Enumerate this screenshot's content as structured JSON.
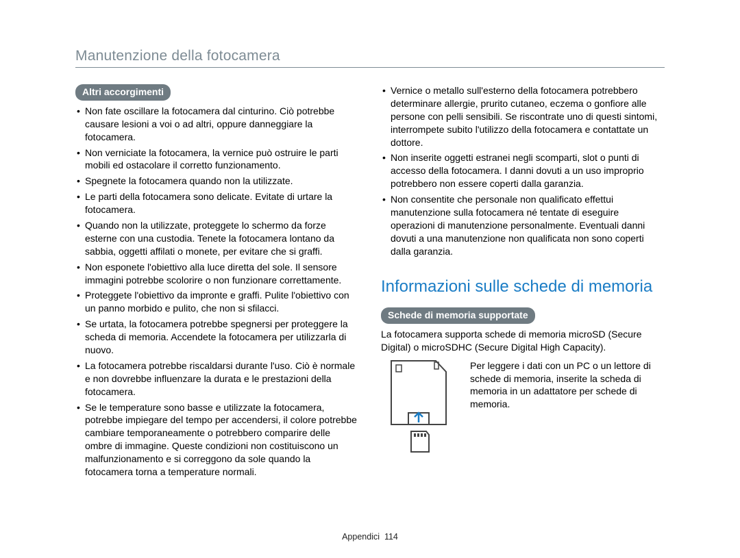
{
  "header": {
    "title": "Manutenzione della fotocamera"
  },
  "left": {
    "heading": "Altri accorgimenti",
    "bullets": [
      "Non fate oscillare la fotocamera dal cinturino. Ciò potrebbe causare lesioni a voi o ad altri, oppure danneggiare la fotocamera.",
      "Non verniciate la fotocamera, la vernice può ostruire le parti mobili ed ostacolare il corretto funzionamento.",
      "Spegnete la fotocamera quando non la utilizzate.",
      "Le parti della fotocamera sono delicate. Evitate di urtare la fotocamera.",
      "Quando non la utilizzate, proteggete lo schermo da forze esterne con una custodia. Tenete la fotocamera lontano da sabbia, oggetti affilati o monete, per evitare che si graffi.",
      "Non esponete l'obiettivo alla luce diretta del sole. Il sensore immagini potrebbe scolorire o non funzionare correttamente.",
      "Proteggete l'obiettivo da impronte e graffi. Pulite l'obiettivo con un panno morbido e pulito, che non si sfilacci.",
      "Se urtata, la fotocamera potrebbe spegnersi per proteggere la scheda di memoria. Accendete la fotocamera per utilizzarla di nuovo.",
      "La fotocamera potrebbe riscaldarsi durante l'uso. Ciò è normale e non dovrebbe influenzare la durata e le prestazioni della fotocamera.",
      "Se le temperature sono basse e utilizzate la fotocamera, potrebbe impiegare del tempo per accendersi, il colore potrebbe cambiare temporaneamente o potrebbero comparire delle ombre di immagine. Queste condizioni non costituiscono un malfunzionamento e si correggono da sole quando la fotocamera torna a temperature normali."
    ]
  },
  "right": {
    "bullets_top": [
      "Vernice o metallo sull'esterno della fotocamera potrebbero determinare allergie, prurito cutaneo, eczema o gonfiore alle persone con pelli sensibili. Se riscontrate uno di questi sintomi, interrompete subito l'utilizzo della fotocamera e contattate un dottore.",
      "Non inserite oggetti estranei negli scomparti, slot o punti di accesso della fotocamera. I danni dovuti a un uso improprio potrebbero non essere coperti dalla garanzia.",
      "Non consentite che personale non qualificato effettui manutenzione sulla fotocamera né tentate di eseguire operazioni di manutenzione personalmente. Eventuali danni dovuti a una manutenzione non qualificata non sono coperti dalla garanzia."
    ],
    "section_title": "Informazioni sulle schede di memoria",
    "subheading": "Schede di memoria supportate",
    "intro": "La fotocamera supporta schede di memoria microSD (Secure Digital) o microSDHC (Secure Digital High Capacity).",
    "card_text": "Per leggere i dati con un PC o un lettore di schede di memoria, inserite la scheda di memoria in un adattatore per schede di memoria."
  },
  "footer": {
    "section": "Appendici",
    "page": "114"
  }
}
